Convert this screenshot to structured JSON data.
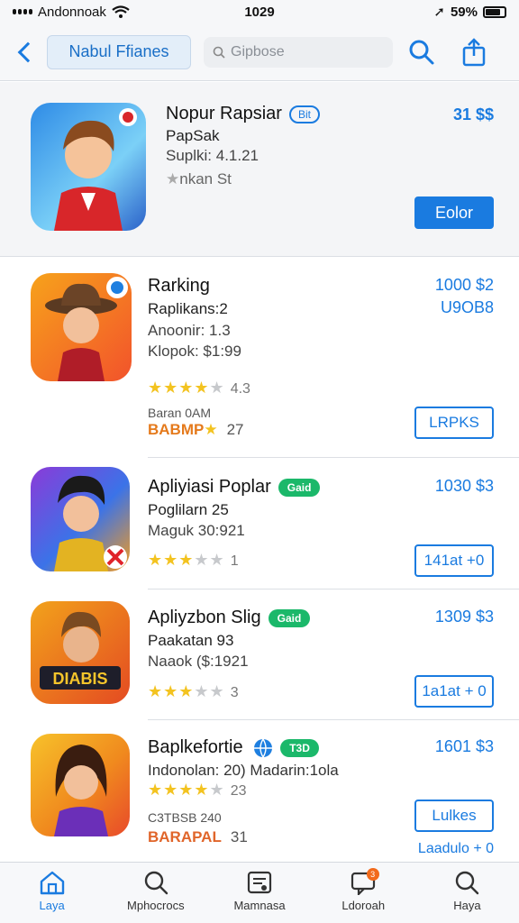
{
  "status_bar": {
    "carrier": "Andonnoak",
    "time": "1029",
    "battery": "59%"
  },
  "nav": {
    "title": "Nabul Ffianes",
    "search_placeholder": "Gipbose",
    "search_icon": "search-icon",
    "share_icon": "share-icon"
  },
  "featured": {
    "name": "Nopur Rapsiar",
    "badge": "Bit",
    "developer": "PapSak",
    "meta": "Suplki: 4.1.21",
    "rating_label": "nkan St",
    "price": "31 $$",
    "button": "Eolor"
  },
  "apps": [
    {
      "name": "Rarking",
      "line1": "Raplikans:2",
      "line2": "Anoonir: 1.3",
      "line3": "Klopok: $1:99",
      "rating": 4.5,
      "rating_count": "4.3",
      "small": "Baran 0AM",
      "orange": "BABMP",
      "orange_num": "27",
      "price": "1000 $2",
      "price_sub": "U9OB8",
      "button": "LRPKS"
    },
    {
      "name": "Apliyiasi Poplar",
      "badge": "Gaid",
      "line1": "Poglilarn 25",
      "line2": "Maguk 30:921",
      "rating": 3.5,
      "rating_count": "1",
      "price": "1030 $3",
      "button": "141at +0"
    },
    {
      "name": "Apliyzbon Slig",
      "badge": "Gaid",
      "line1": "Paakatan 93",
      "line2": "Naaok ($:1921",
      "rating": 3,
      "rating_count": "3",
      "price": "1309 $3",
      "button": "1a1at + 0"
    },
    {
      "name": "Baplkefortie",
      "badge": "T3D",
      "line1": "Indonolan: 20) Madarin:1ola",
      "rating": 4,
      "rating_count": "23",
      "small": "C3TBSB 240",
      "orange": "BARAPAL",
      "orange_num": "31",
      "price": "1601 $3",
      "button": "Lulkes",
      "button_sub": "Laadulo + 0"
    }
  ],
  "tabs": [
    {
      "label": "Laya",
      "icon": "home-icon"
    },
    {
      "label": "Mphocrocs",
      "icon": "search-icon"
    },
    {
      "label": "Mamnasa",
      "icon": "document-icon"
    },
    {
      "label": "Ldoroah",
      "icon": "message-icon",
      "badge": "3"
    },
    {
      "label": "Haya",
      "icon": "search-icon"
    }
  ],
  "colors": {
    "accent": "#1a7be0",
    "green": "#1bb86a",
    "star": "#f3c320",
    "orange": "#e57a1c"
  }
}
